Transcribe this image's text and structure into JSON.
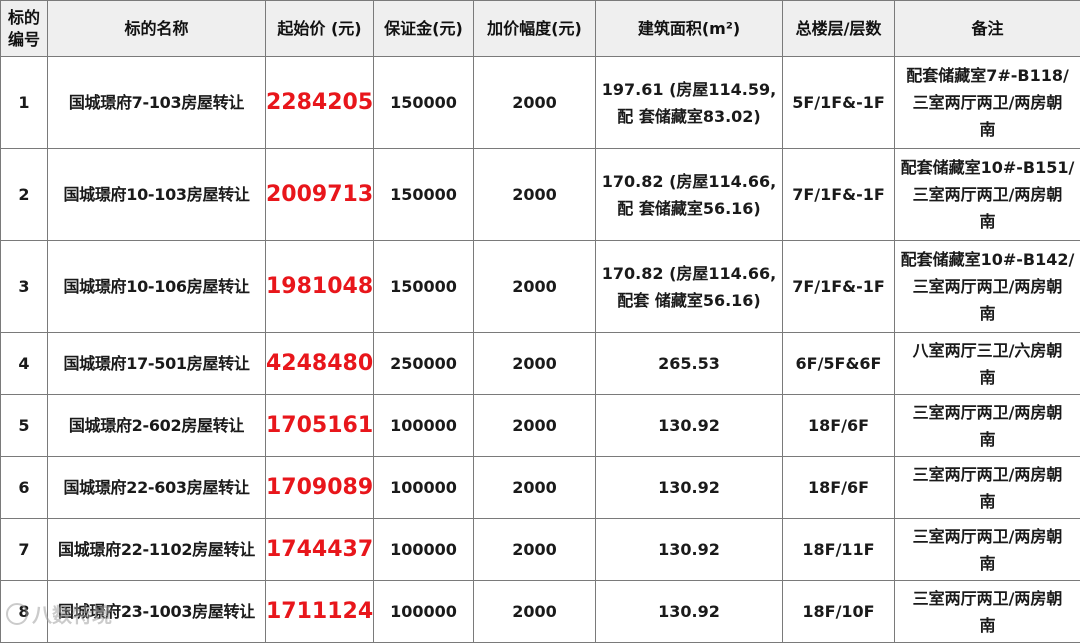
{
  "headers": [
    "标的\n编号",
    "标的名称",
    "起始价 (元)",
    "保证金(元)",
    "加价幅度(元)",
    "建筑面积(m²)",
    "总楼层/层数",
    "备注"
  ],
  "rows": [
    {
      "no": "1",
      "name": "国城璟府7-103房屋转让",
      "price": "2284205",
      "deposit": "150000",
      "increment": "2000",
      "area": "197.61 (房屋114.59,\n配 套储藏室83.02)",
      "floors": "5F/1F&-1F",
      "remark": "配套储藏室7#-B118/\n三室两厅两卫/两房朝\n南"
    },
    {
      "no": "2",
      "name": "国城璟府10-103房屋转让",
      "price": "2009713",
      "deposit": "150000",
      "increment": "2000",
      "area": "170.82 (房屋114.66,\n配 套储藏室56.16)",
      "floors": "7F/1F&-1F",
      "remark": "配套储藏室10#-B151/\n三室两厅两卫/两房朝\n南"
    },
    {
      "no": "3",
      "name": "国城璟府10-106房屋转让",
      "price": "1981048",
      "deposit": "150000",
      "increment": "2000",
      "area": "170.82 (房屋114.66,\n配套 储藏室56.16)",
      "floors": "7F/1F&-1F",
      "remark": "配套储藏室10#-B142/\n三室两厅两卫/两房朝\n南"
    },
    {
      "no": "4",
      "name": "国城璟府17-501房屋转让",
      "price": "4248480",
      "deposit": "250000",
      "increment": "2000",
      "area": "265.53",
      "floors": "6F/5F&6F",
      "remark": "八室两厅三卫/六房朝\n南"
    },
    {
      "no": "5",
      "name": "国城璟府2-602房屋转让",
      "price": "1705161",
      "deposit": "100000",
      "increment": "2000",
      "area": "130.92",
      "floors": "18F/6F",
      "remark": "三室两厅两卫/两房朝\n南"
    },
    {
      "no": "6",
      "name": "国城璟府22-603房屋转让",
      "price": "1709089",
      "deposit": "100000",
      "increment": "2000",
      "area": "130.92",
      "floors": "18F/6F",
      "remark": "三室两厅两卫/两房朝\n南"
    },
    {
      "no": "7",
      "name": "国城璟府22-1102房屋转让",
      "price": "1744437",
      "deposit": "100000",
      "increment": "2000",
      "area": "130.92",
      "floors": "18F/11F",
      "remark": "三室两厅两卫/两房朝\n南"
    },
    {
      "no": "8",
      "name": "国城璟府23-1003房屋转让",
      "price": "1711124",
      "deposit": "100000",
      "increment": "2000",
      "area": "130.92",
      "floors": "18F/10F",
      "remark": "三室两厅两卫/两房朝\n南"
    }
  ],
  "watermark": "八数特境",
  "colors": {
    "price": "#e8161b",
    "header_bg": "#efefef",
    "border": "#7a7a7a"
  }
}
